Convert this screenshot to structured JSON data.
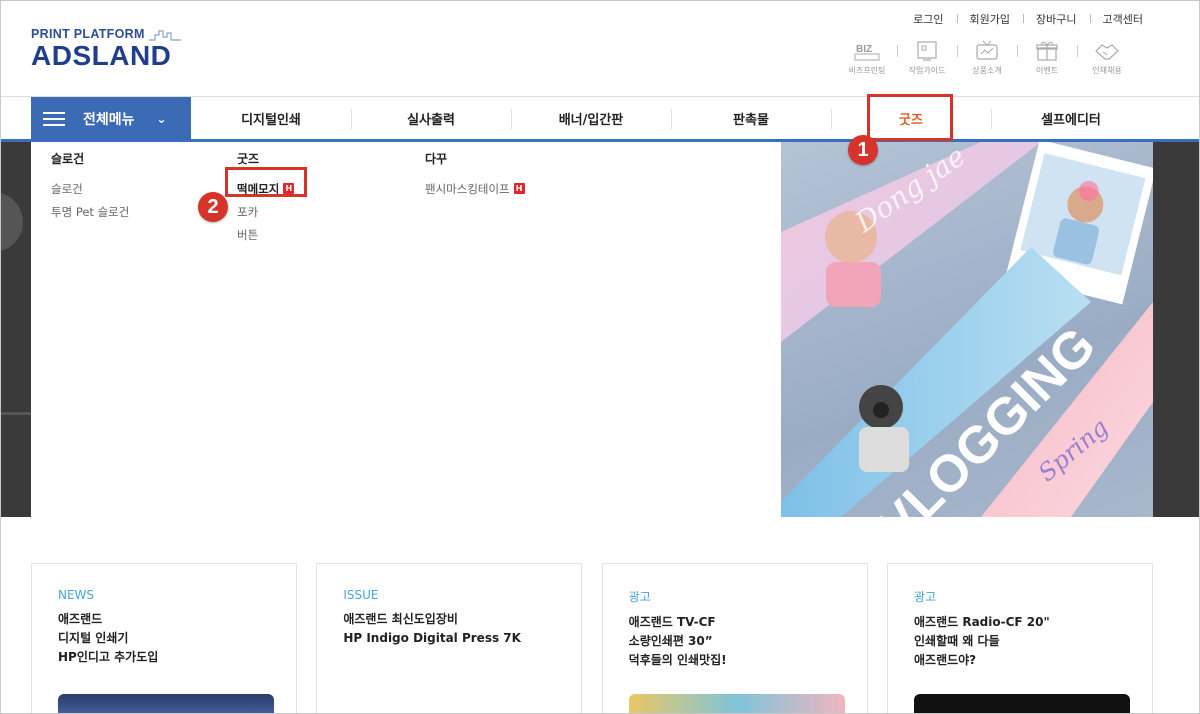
{
  "logo": {
    "sub": "PRINT PLATFORM",
    "main": "ADSLAND"
  },
  "top_links": [
    "로그인",
    "회원가입",
    "장바구니",
    "고객센터"
  ],
  "quick_links": [
    {
      "label": "비즈프린팅",
      "icon": "biz-icon"
    },
    {
      "label": "작업가이드",
      "icon": "guide-icon"
    },
    {
      "label": "상품소개",
      "icon": "tv-icon"
    },
    {
      "label": "이벤트",
      "icon": "gift-icon"
    },
    {
      "label": "인재채용",
      "icon": "handshake-icon"
    }
  ],
  "gnb": {
    "all_menu": "전체메뉴",
    "items": [
      "디지털인쇄",
      "실사출력",
      "배너/입간판",
      "판촉물",
      "굿즈",
      "셀프에디터"
    ],
    "active": "굿즈"
  },
  "mega_menu": {
    "columns": [
      {
        "heading": "슬로건",
        "items": [
          "슬로건",
          "투명 Pet 슬로건"
        ]
      },
      {
        "heading": "굿즈",
        "items": [
          "떡메모지",
          "포카",
          "버튼"
        ]
      },
      {
        "heading": "다꾸",
        "items": [
          "팬시마스킹테이프"
        ]
      }
    ],
    "badge": "H"
  },
  "steps": [
    "1",
    "2"
  ],
  "banner": {
    "text1": "VLOGGING",
    "text2": "Spring",
    "text3": "Dong jae"
  },
  "news": [
    {
      "tag": "NEWS",
      "text": "애즈랜드\n디지털 인쇄기\nHP인디고 추가도입"
    },
    {
      "tag": "ISSUE",
      "text": "애즈랜드 최신도입장비\nHP Indigo Digital Press 7K"
    },
    {
      "tag": "광고",
      "text": "애즈랜드 TV-CF\n소량인쇄편 30”\n덕후들의 인쇄맛집!"
    },
    {
      "tag": "광고",
      "text": "애즈랜드 Radio-CF 20\"\n인쇄할때 왜 다들\n애즈랜드야?"
    }
  ],
  "colors": {
    "brand": "#1f3f8a",
    "gnb_blue": "#3b6bb5",
    "active": "#e95a22",
    "highlight": "#d6342a",
    "news_tag": "#4aa3d8"
  }
}
